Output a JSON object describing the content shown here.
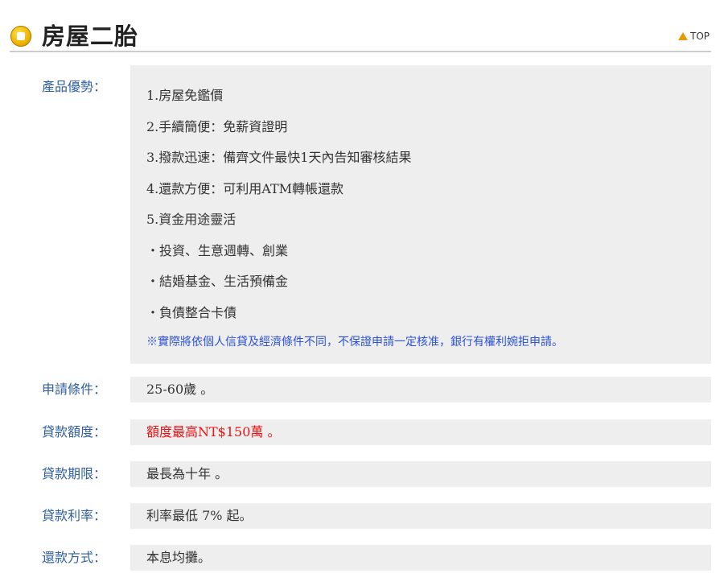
{
  "header": {
    "title": "房屋二胎",
    "top_label": "TOP"
  },
  "advantages": {
    "label": "產品優勢：",
    "items": [
      "1.房屋免鑑價",
      "2.手續簡便：免薪資證明",
      "3.撥款迅速：備齊文件最快1天內告知審核結果",
      "4.還款方便：可利用ATM轉帳還款",
      "5.資金用途靈活",
      "・投資、生意週轉、創業",
      "・結婚基金、生活預備金",
      "・負債整合卡債"
    ],
    "note": "※實際將依個人信貸及經濟條件不同，不保證申請一定核准，銀行有權利婉拒申請。"
  },
  "conditions": {
    "label": "申請條件：",
    "value": "25-60歲 。"
  },
  "amount": {
    "label": "貸款額度：",
    "value": "額度最高NT$150萬 。"
  },
  "term": {
    "label": "貸款期限：",
    "value": "最長為十年 。"
  },
  "rate": {
    "label": "貸款利率：",
    "value": "利率最低 7% 起。"
  },
  "repayment": {
    "label": "還款方式：",
    "value": "本息均攤。"
  },
  "colors": {
    "label_blue": "#2f5fa0",
    "note_blue": "#2b52d6",
    "highlight_red": "#ee1111",
    "box_gray": "#eeeeee",
    "top_triangle": "#e69a00"
  }
}
